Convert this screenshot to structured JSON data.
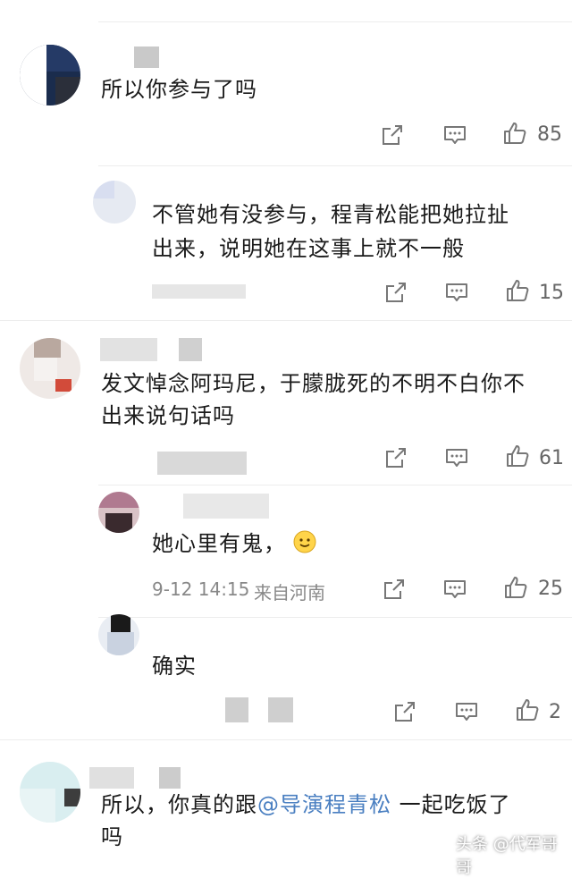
{
  "comments": [
    {
      "text": "所以你参与了吗",
      "likes": "85"
    },
    {
      "text_line1": "不管她有没参与，程青松能把她拉扯",
      "text_line2": "出来，说明她在这事上就不一般",
      "likes": "15"
    },
    {
      "text_line1": "发文悼念阿玛尼，于朦胧死的不明不白你不",
      "text_line2": "出来说句话吗",
      "likes": "61"
    },
    {
      "text": "她心里有鬼，",
      "date": "9-12 14:15",
      "location": "来自河南",
      "likes": "25",
      "emoji": "smile-emoji"
    },
    {
      "text": "确实",
      "likes": "2"
    },
    {
      "text_before": "所以，你真的跟",
      "mention": "@导演程青松",
      "text_after": " 一起吃饭了",
      "text_line2": "吗"
    }
  ],
  "watermark": "头条 @代军哥哥",
  "icons": {
    "share": "share-icon",
    "comment": "comment-icon",
    "like": "thumbs-up-icon"
  },
  "colors": {
    "mention": "#4a7fc1",
    "meta": "#888888",
    "text": "#1a1a1a"
  }
}
